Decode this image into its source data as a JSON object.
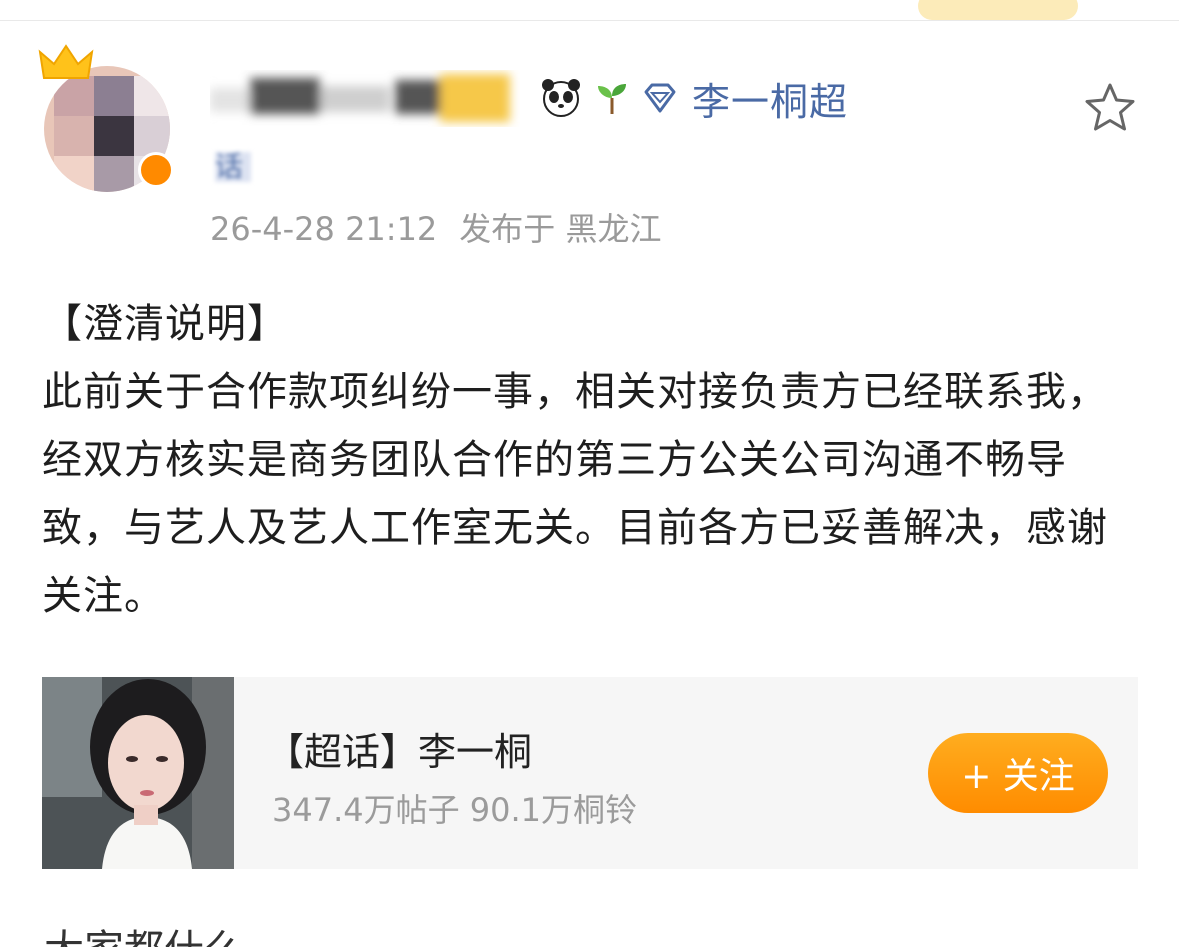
{
  "profile": {
    "super_topic_link": "李一桐超",
    "name_tail_fragment": "话"
  },
  "post": {
    "timestamp": "26-4-28 21:12",
    "location": "发布于 黑龙江",
    "paragraphs": [
      "【澄清说明】",
      "此前关于合作款项纠纷一事，相关对接负责方已经联系我，经双方核实是商务团队合作的第三方公关公司沟通不畅导致，与艺人及艺人工作室无关。目前各方已妥善解决，感谢关注。"
    ]
  },
  "topic_card": {
    "title": "【超话】李一桐",
    "stats": "347.4万帖子 90.1万桐铃",
    "follow_label": "+ 关注"
  },
  "footer_partial": "大家都什么",
  "icons": [
    "crown-icon",
    "verified-badge-icon",
    "panda-icon",
    "sprout-icon",
    "diamond-icon",
    "star-icon"
  ],
  "colors": {
    "link_blue": "#4a6aa5",
    "meta_gray": "#9a9a9a",
    "follow_orange": "#ff9a0a",
    "card_bg": "#f6f6f6"
  }
}
